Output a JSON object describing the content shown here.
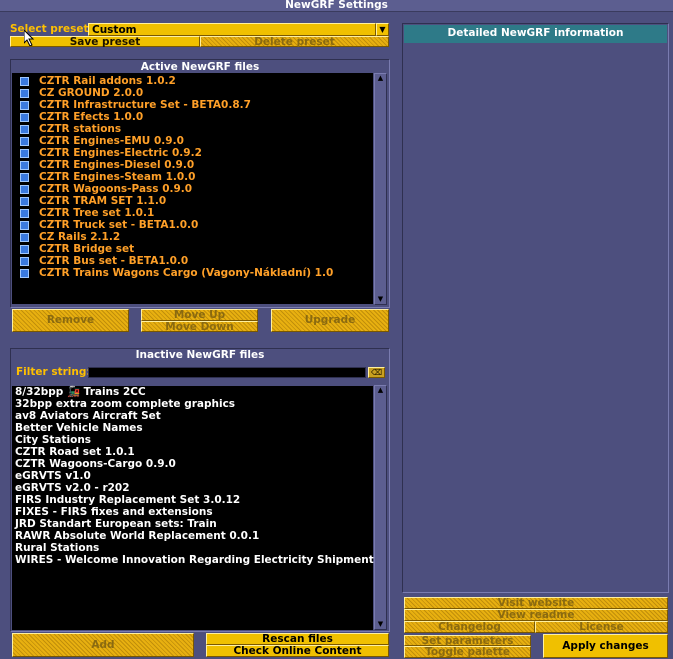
{
  "window": {
    "title": "NewGRF Settings"
  },
  "preset": {
    "label": "Select preset:",
    "value": "Custom",
    "save_label": "Save preset",
    "delete_label": "Delete preset"
  },
  "active": {
    "header": "Active NewGRF files",
    "items": [
      "CZTR Rail addons 1.0.2",
      "CZ GROUND 2.0.0",
      "CZTR Infrastructure Set - BETA0.8.7",
      "CZTR Efects 1.0.0",
      "CZTR stations",
      "CZTR Engines-EMU 0.9.0",
      "CZTR Engines-Electric 0.9.2",
      "CZTR Engines-Diesel 0.9.0",
      "CZTR Engines-Steam 1.0.0",
      "CZTR Wagoons-Pass 0.9.0",
      "CZTR TRAM SET 1.1.0",
      "CZTR Tree set 1.0.1",
      "CZTR Truck set - BETA1.0.0",
      "CZ Rails 2.1.2",
      "CZTR Bridge set",
      "CZTR Bus set - BETA1.0.0",
      "CZTR Trains Wagons Cargo (Vagony-Nákladní) 1.0"
    ],
    "remove_label": "Remove",
    "move_up_label": "Move Up",
    "move_down_label": "Move Down",
    "upgrade_label": "Upgrade"
  },
  "inactive": {
    "header": "Inactive NewGRF files",
    "filter_label": "Filter string:",
    "filter_value": "",
    "clear_glyph": "⌫",
    "items": [
      "8/32bpp 🚂 Trains 2CC",
      "32bpp extra zoom complete graphics",
      "av8 Aviators Aircraft Set",
      "Better Vehicle Names",
      "City Stations",
      "CZTR Road set 1.0.1",
      "CZTR Wagoons-Cargo 0.9.0",
      "eGRVTS v1.0",
      "eGRVTS v2.0 - r202",
      "FIRS Industry Replacement Set 3.0.12",
      "FIXES - FIRS fixes and extensions",
      "JRD Standart European sets: Train",
      "RAWR Absolute World Replacement 0.0.1",
      "Rural Stations",
      "WIRES - Welcome Innovation Regarding Electricity Shipment"
    ],
    "add_label": "Add",
    "rescan_label": "Rescan files",
    "check_online_label": "Check Online Content"
  },
  "info": {
    "header": "Detailed NewGRF information",
    "visit_website_label": "Visit website",
    "view_readme_label": "View readme",
    "changelog_label": "Changelog",
    "license_label": "License",
    "set_parameters_label": "Set parameters",
    "toggle_palette_label": "Toggle palette",
    "apply_label": "Apply changes"
  },
  "icons": {
    "dropdown": "dropdown-arrow-icon",
    "scroll_up": "scroll-up-icon",
    "scroll_down": "scroll-down-icon",
    "grf_status": "blue-square-icon",
    "cursor": "mouse-pointer-icon"
  },
  "colors": {
    "window_bg": "#4d4f7e",
    "accent_button": "#e8b010",
    "active_text": "#ffa028",
    "info_header": "#2e7a88"
  }
}
